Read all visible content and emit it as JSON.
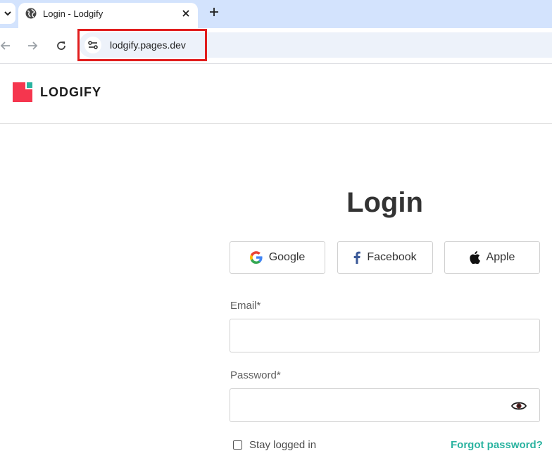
{
  "browser": {
    "tab": {
      "title": "Login - Lodgify"
    },
    "address_bar": {
      "url": "lodgify.pages.dev"
    }
  },
  "site": {
    "brand_name": "LODGIFY",
    "colors": {
      "brand_red": "#f5364e",
      "brand_teal": "#2bb3a0"
    }
  },
  "login": {
    "title": "Login",
    "social": {
      "google": "Google",
      "facebook": "Facebook",
      "apple": "Apple"
    },
    "email_label": "Email*",
    "email_value": "",
    "password_label": "Password*",
    "password_value": "",
    "stay_logged_in": "Stay logged in",
    "stay_logged_in_checked": false,
    "forgot_password": "Forgot password?"
  }
}
